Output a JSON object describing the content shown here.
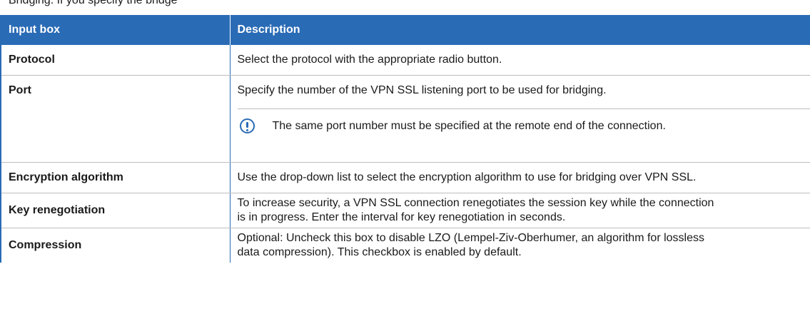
{
  "caption": {
    "prefix": "",
    "text": "Bridging. If you specify the bridge"
  },
  "table": {
    "headers": [
      "Input box",
      "Description"
    ],
    "rows": [
      {
        "label": "Protocol",
        "description": "Select the protocol with the appropriate radio button."
      },
      {
        "label": "Port",
        "description": "Specify the number of the VPN SSL listening port to be used for bridging.",
        "note_icon": "exclamation-circle-icon",
        "note": "The same port number must be specified at the remote end of the connection."
      },
      {
        "label": "Encryption algorithm",
        "description": "Use the drop-down list to select the encryption algorithm to use for bridging over VPN SSL."
      },
      {
        "label": "Key renegotiation",
        "description_lines": [
          "To increase security, a VPN SSL connection renegotiates the session key while the connection",
          "is in progress. Enter the interval for key renegotiation in seconds."
        ]
      },
      {
        "label": "Compression",
        "description_lines": [
          "Optional: Uncheck this box to disable LZO (Lempel-Ziv-Oberhumer, an algorithm for lossless",
          "data compression). This checkbox is enabled by default."
        ]
      }
    ]
  },
  "colors": {
    "header_bg": "#2a6bb6",
    "header_text": "#ffffff",
    "accent": "#2a6bb6",
    "row_divider": "#bdbdbd"
  }
}
